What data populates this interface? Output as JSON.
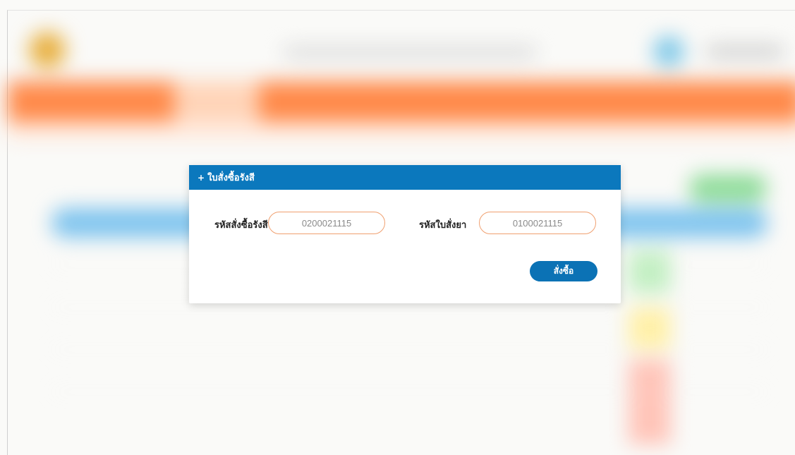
{
  "modal": {
    "title": "ใบสั่งซื้อรังสี",
    "title_icon": "plus-icon",
    "fields": [
      {
        "label": "รหัสสั่งซื้อรังสี",
        "value": "0200021115"
      },
      {
        "label": "รหัสใบสั่งยา",
        "value": "0100021115"
      }
    ],
    "submit_label": "สั่งซื้อ"
  },
  "colors": {
    "header": "#0b78bd",
    "field_border": "#f0a070",
    "button": "#0b72b5",
    "nav_background": "#ff8a4a"
  }
}
